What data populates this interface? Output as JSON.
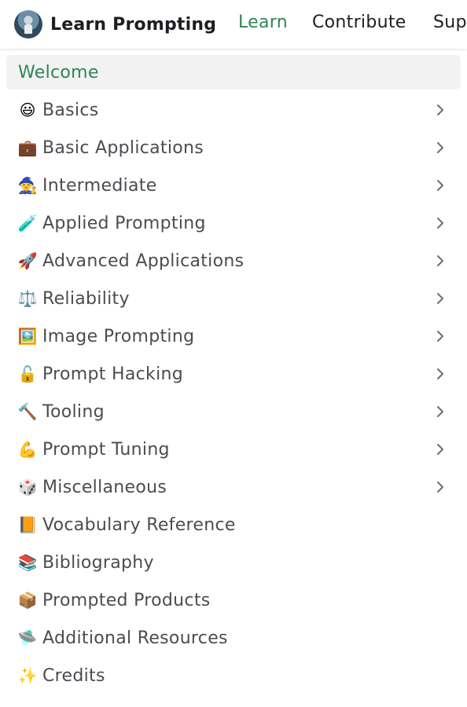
{
  "navbar": {
    "brand": "Learn Prompting",
    "links": [
      "Learn",
      "Contribute",
      "Sup"
    ]
  },
  "sidebar": {
    "items": [
      {
        "emoji": "",
        "label": "Welcome",
        "active": true,
        "has_children": false
      },
      {
        "emoji": "😃",
        "label": "Basics",
        "has_children": true
      },
      {
        "emoji": "💼",
        "label": "Basic Applications",
        "has_children": true
      },
      {
        "emoji": "🧙",
        "label": "Intermediate",
        "has_children": true
      },
      {
        "emoji": "🧪",
        "label": "Applied Prompting",
        "has_children": true
      },
      {
        "emoji": "🚀",
        "label": "Advanced Applications",
        "has_children": true
      },
      {
        "emoji": "⚖️",
        "label": "Reliability",
        "has_children": true
      },
      {
        "emoji": "🖼️",
        "label": "Image Prompting",
        "has_children": true
      },
      {
        "emoji": "🔓",
        "label": "Prompt Hacking",
        "has_children": true
      },
      {
        "emoji": "🔨",
        "label": "Tooling",
        "has_children": true
      },
      {
        "emoji": "💪",
        "label": "Prompt Tuning",
        "has_children": true
      },
      {
        "emoji": "🎲",
        "label": "Miscellaneous",
        "has_children": true
      },
      {
        "emoji": "📙",
        "label": "Vocabulary Reference",
        "has_children": false
      },
      {
        "emoji": "📚",
        "label": "Bibliography",
        "has_children": false
      },
      {
        "emoji": "📦",
        "label": "Prompted Products",
        "has_children": false
      },
      {
        "emoji": "🛸",
        "label": "Additional Resources",
        "has_children": false
      },
      {
        "emoji": "✨",
        "label": "Credits",
        "has_children": false
      }
    ]
  },
  "colors": {
    "accent": "#2e8555",
    "text": "#4a4c51",
    "active_bg": "#f2f2f2"
  },
  "icons": {
    "logo": "astronaut-logo-icon",
    "expand": "chevron-right-icon"
  }
}
